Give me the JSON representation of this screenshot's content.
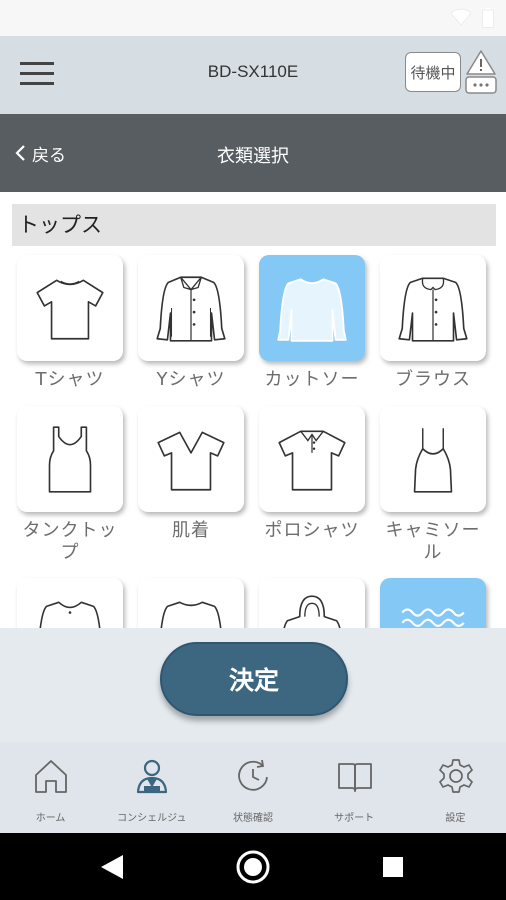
{
  "app_bar": {
    "device_name": "BD-SX110E",
    "status_button": "待機中"
  },
  "title_bar": {
    "back_label": "戻る",
    "title": "衣類選択"
  },
  "section": {
    "title": "トップス"
  },
  "items": [
    {
      "label": "Tシャツ",
      "icon": "tshirt-icon",
      "selected": false
    },
    {
      "label": "Yシャツ",
      "icon": "dress-shirt-icon",
      "selected": false
    },
    {
      "label": "カットソー",
      "icon": "cut-and-sewn-icon",
      "selected": true
    },
    {
      "label": "ブラウス",
      "icon": "blouse-icon",
      "selected": false
    },
    {
      "label": "タンクトッ\nプ",
      "icon": "tank-top-icon",
      "selected": false
    },
    {
      "label": "肌着",
      "icon": "undershirt-icon",
      "selected": false
    },
    {
      "label": "ポロシャツ",
      "icon": "polo-shirt-icon",
      "selected": false
    },
    {
      "label": "キャミソー\nル",
      "icon": "camisole-icon",
      "selected": false
    },
    {
      "label": "",
      "icon": "cardigan-icon",
      "selected": false
    },
    {
      "label": "",
      "icon": "sweatshirt-icon",
      "selected": false
    },
    {
      "label": "",
      "icon": "hoodie-icon",
      "selected": false
    },
    {
      "label": "",
      "icon": "knit-sweater-icon",
      "selected": true
    }
  ],
  "action": {
    "decide_label": "決定"
  },
  "bottom_nav": [
    {
      "label": "ホーム",
      "icon": "home-icon"
    },
    {
      "label": "コンシェルジュ",
      "icon": "concierge-icon",
      "active": true
    },
    {
      "label": "状態確認",
      "icon": "status-clock-icon"
    },
    {
      "label": "サポート",
      "icon": "support-book-icon"
    },
    {
      "label": "設定",
      "icon": "settings-gear-icon"
    }
  ],
  "colors": {
    "accent": "#3d6680",
    "selected_card": "#84c8f6",
    "title_bar": "#585d62",
    "app_bar": "#d6dde3"
  }
}
